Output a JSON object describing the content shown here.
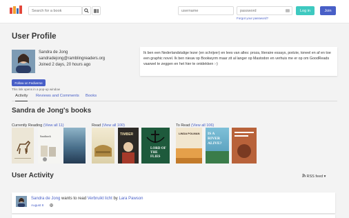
{
  "header": {
    "search_placeholder": "Search for a book",
    "username_placeholder": "username",
    "password_placeholder": "password",
    "forgot_password": "Forgot your password?",
    "login_label": "Log in",
    "join_label": "Join",
    "accent_color": "#3ec9c0",
    "brand_color": "#485fc7"
  },
  "profile": {
    "title": "User Profile",
    "name": "Sandra de Jong",
    "handle": "sandradejong@ramblingreaders.org",
    "joined": "Joined 2 days, 20 hours ago",
    "bio": "Ik ben een Nederlandstalige lezer (en schrijver) en lees van alles: proza, literaire essays, poëzie, toneel en af en toe een graphic novel. Ik ben nieuw op Bookwyrm maar zit al langer op Mastodon en verhuis me er op om GoodReads vaarwel te zeggen en het hier te ontdekken :-)",
    "follow_button": "Follow on Fediverse",
    "follow_note": "This link opens in a pop-up window"
  },
  "tabs": [
    "Activity",
    "Reviews and Comments",
    "Books"
  ],
  "books_section": {
    "title": "Sandra de Jong's books",
    "shelves": [
      {
        "name": "Currently Reading",
        "view_all": "(View all 11)"
      },
      {
        "name": "Read",
        "view_all": "(View all 100)"
      },
      {
        "name": "To Read",
        "view_all": "(View all 106)"
      }
    ],
    "cover_texts": [
      "Saadtrack",
      "TIMBER",
      "LORD OF THE FLIES",
      "LINDA POLMAN",
      "IS A RIVER ALIVE?"
    ]
  },
  "activity": {
    "title": "User Activity",
    "rss_label": "RSS feed",
    "item": {
      "user": "Sandra de Jong",
      "action": "wants to read",
      "book": "Verbruikt licht",
      "by": "by",
      "author": "Lara Pawson",
      "date": "August 8"
    }
  }
}
